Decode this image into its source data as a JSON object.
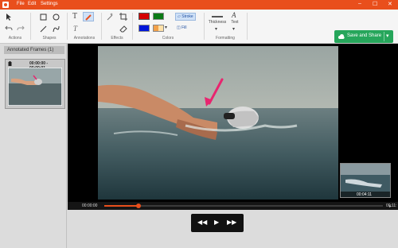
{
  "window": {
    "menu": [
      "File",
      "Edit",
      "Settings"
    ],
    "minimize": "–",
    "maximize": "☐",
    "close": "✕"
  },
  "ribbon": {
    "groups": {
      "actions": "Actions",
      "shapes": "Shapes",
      "annotations": "Annotations",
      "effects": "Effects",
      "colors": "Colors",
      "formatting": "Formatting"
    },
    "colors": {
      "swatch_red": "#d40000",
      "swatch_green": "#0b7a16",
      "swatch_blue": "#0016d9",
      "swatch_multi": "#f2a14a",
      "stroke_label": "Stroke",
      "fill_label": "Fill"
    },
    "formatting": {
      "thickness_label": "Thickness",
      "text_label": "Text"
    },
    "save_label": "Save and Share"
  },
  "left_panel": {
    "header": "Annotated Frames (1)",
    "frame": {
      "time_range": "00:00:00 - 00:00:01"
    }
  },
  "thumbnail": {
    "timestamp": "00:04:11"
  },
  "timeline": {
    "start_time": "00:00:00",
    "end_time": "00:11:",
    "progress": 0.122
  },
  "accent": "#e94f1c",
  "annotation_color": "#e8256f"
}
